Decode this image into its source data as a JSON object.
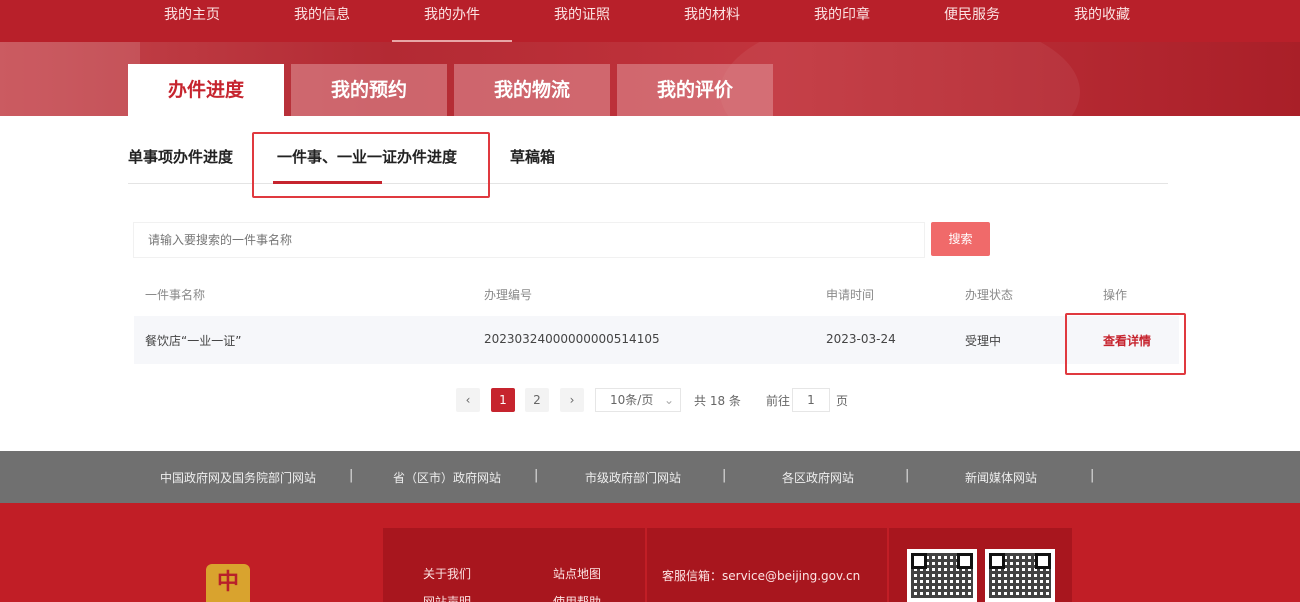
{
  "topnav": {
    "items": [
      "我的主页",
      "我的信息",
      "我的办件",
      "我的证照",
      "我的材料",
      "我的印章",
      "便民服务",
      "我的收藏"
    ],
    "active_index": 2
  },
  "main_tabs": [
    "办件进度",
    "我的预约",
    "我的物流",
    "我的评价"
  ],
  "sub_tabs": [
    "单事项办件进度",
    "一件事、一业一证办件进度",
    "草稿箱"
  ],
  "search": {
    "placeholder": "请输入要搜索的一件事名称",
    "button_label": "搜索"
  },
  "table": {
    "headers": [
      "一件事名称",
      "办理编号",
      "申请时间",
      "办理状态",
      "操作"
    ],
    "rows": [
      {
        "name": "餐饮店“一业一证”",
        "number": "20230324000000000514105",
        "date": "2023-03-24",
        "status": "受理中",
        "action": "查看详情"
      }
    ]
  },
  "pagination": {
    "prev": "‹",
    "pages": [
      "1",
      "2"
    ],
    "next": "›",
    "page_size": "10条/页",
    "total": "共 18 条",
    "goto_label": "前往",
    "goto_value": "1",
    "page_unit": "页"
  },
  "links_bar": [
    "中国政府网及国务院部门网站",
    "省（区市）政府网站",
    "市级政府部门网站",
    "各区政府网站",
    "新闻媒体网站"
  ],
  "footer": {
    "links_col1": [
      "关于我们",
      "网站声明"
    ],
    "links_col2": [
      "站点地图",
      "使用帮助"
    ],
    "service_email": "客服信箱：service@beijing.gov.cn",
    "emblem_glyph": "中"
  },
  "colors": {
    "brand_red": "#c6242e",
    "nav_red": "#b8202a",
    "search_button": "#f06a6a",
    "links_bar_gray": "#707070",
    "highlight_outline": "#e0393f"
  }
}
